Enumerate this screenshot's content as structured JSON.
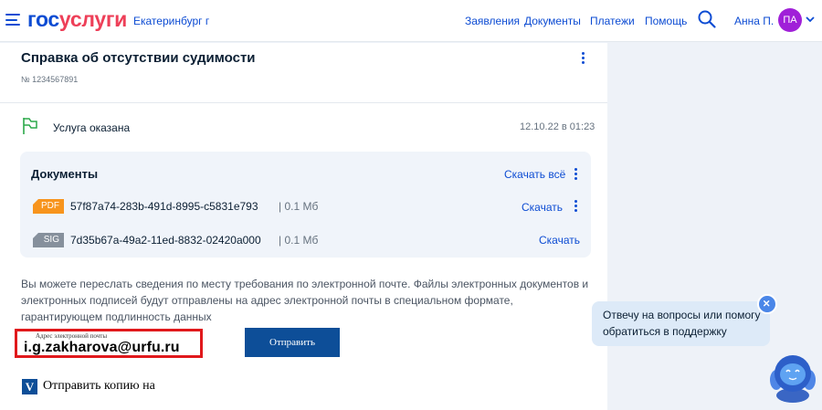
{
  "header": {
    "logo_part1": "гос",
    "logo_part2": "услуги",
    "city": "Екатеринбург г",
    "nav": [
      "Заявления",
      "Документы",
      "Платежи",
      "Помощь"
    ],
    "user_name": "Анна П.",
    "avatar_initials": "ПА",
    "icons": {
      "menu": "hamburger-icon",
      "search": "search-icon",
      "dropdown": "chevron-down-icon"
    }
  },
  "service": {
    "title": "Справка об отсутствии судимости",
    "number": "№ 1234567891",
    "status": "Услуга оказана",
    "date": "12.10.22 в 01:23"
  },
  "documents": {
    "title": "Документы",
    "download_all": "Скачать всё",
    "files": [
      {
        "type": "PDF",
        "name": "57f87a74-283b-491d-8995-c5831e793",
        "size": "| 0.1 Мб",
        "download": "Скачать",
        "color": "#f7941d"
      },
      {
        "type": "SIG",
        "name": "7d35b67a-49a2-11ed-8832-02420a000",
        "size": "| 0.1 Мб",
        "download": "Скачать",
        "color": "#86909c"
      }
    ]
  },
  "email_section": {
    "info": "Вы можете переслать сведения по месту требования по электронной почте. Файлы электронных документов и электронных подписей будут отправлены на адрес электронной почты в специальном формате, гарантирующем подлинность данных",
    "email_label": "Адрес электронной почты",
    "email_value": "i.g.zakharova@urfu.ru",
    "send_button": "Отправить",
    "copy_checkbox_mark": "V",
    "copy_label": "Отправить копию на"
  },
  "support": {
    "bubble_text": "Отвечу на вопросы или помогу обратиться в поддержку"
  },
  "colors": {
    "brand_blue": "#0d4cd3",
    "brand_red": "#ee3f58",
    "accent_red_frame": "#e0191c",
    "button_blue": "#0d4e98"
  }
}
